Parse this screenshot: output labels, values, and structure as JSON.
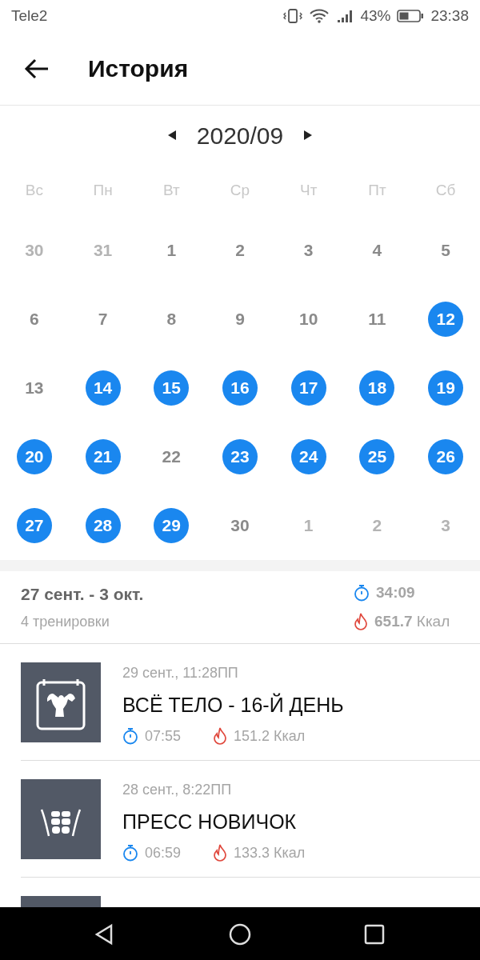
{
  "status_bar": {
    "carrier": "Tele2",
    "battery_percent": "43%",
    "time": "23:38"
  },
  "header": {
    "title": "История"
  },
  "calendar": {
    "month": "2020/09",
    "weekdays": [
      "Вс",
      "Пн",
      "Вт",
      "Ср",
      "Чт",
      "Пт",
      "Сб"
    ],
    "days": [
      {
        "label": "30",
        "kind": "other",
        "done": false
      },
      {
        "label": "31",
        "kind": "other",
        "done": false
      },
      {
        "label": "1",
        "kind": "current",
        "done": false
      },
      {
        "label": "2",
        "kind": "current",
        "done": false
      },
      {
        "label": "3",
        "kind": "current",
        "done": false
      },
      {
        "label": "4",
        "kind": "current",
        "done": false
      },
      {
        "label": "5",
        "kind": "current",
        "done": false
      },
      {
        "label": "6",
        "kind": "current",
        "done": false
      },
      {
        "label": "7",
        "kind": "current",
        "done": false
      },
      {
        "label": "8",
        "kind": "current",
        "done": false
      },
      {
        "label": "9",
        "kind": "current",
        "done": false
      },
      {
        "label": "10",
        "kind": "current",
        "done": false
      },
      {
        "label": "11",
        "kind": "current",
        "done": false
      },
      {
        "label": "12",
        "kind": "current",
        "done": true
      },
      {
        "label": "13",
        "kind": "current",
        "done": false
      },
      {
        "label": "14",
        "kind": "current",
        "done": true
      },
      {
        "label": "15",
        "kind": "current",
        "done": true
      },
      {
        "label": "16",
        "kind": "current",
        "done": true
      },
      {
        "label": "17",
        "kind": "current",
        "done": true
      },
      {
        "label": "18",
        "kind": "current",
        "done": true
      },
      {
        "label": "19",
        "kind": "current",
        "done": true
      },
      {
        "label": "20",
        "kind": "current",
        "done": true
      },
      {
        "label": "21",
        "kind": "current",
        "done": true
      },
      {
        "label": "22",
        "kind": "current",
        "done": false
      },
      {
        "label": "23",
        "kind": "current",
        "done": true
      },
      {
        "label": "24",
        "kind": "current",
        "done": true
      },
      {
        "label": "25",
        "kind": "current",
        "done": true
      },
      {
        "label": "26",
        "kind": "current",
        "done": true
      },
      {
        "label": "27",
        "kind": "current",
        "done": true
      },
      {
        "label": "28",
        "kind": "current",
        "done": true
      },
      {
        "label": "29",
        "kind": "current",
        "done": true
      },
      {
        "label": "30",
        "kind": "current",
        "done": false
      },
      {
        "label": "1",
        "kind": "other",
        "done": false
      },
      {
        "label": "2",
        "kind": "other",
        "done": false
      },
      {
        "label": "3",
        "kind": "other",
        "done": false
      }
    ]
  },
  "week_summary": {
    "range": "27 сент. - 3 окт.",
    "count": "4 тренировки",
    "duration": "34:09",
    "calories_value": "651.7",
    "calories_unit": "Ккал"
  },
  "workouts": [
    {
      "date": "29 сент., 11:28ПП",
      "title": "ВСЁ ТЕЛО - 16-Й ДЕНЬ",
      "duration": "07:55",
      "calories": "151.2 Ккал",
      "kind": "fullbody"
    },
    {
      "date": "28 сент., 8:22ПП",
      "title": "ПРЕСС НОВИЧОК",
      "duration": "06:59",
      "calories": "133.3 Ккал",
      "kind": "abs"
    },
    {
      "kind": "partial"
    }
  ]
}
